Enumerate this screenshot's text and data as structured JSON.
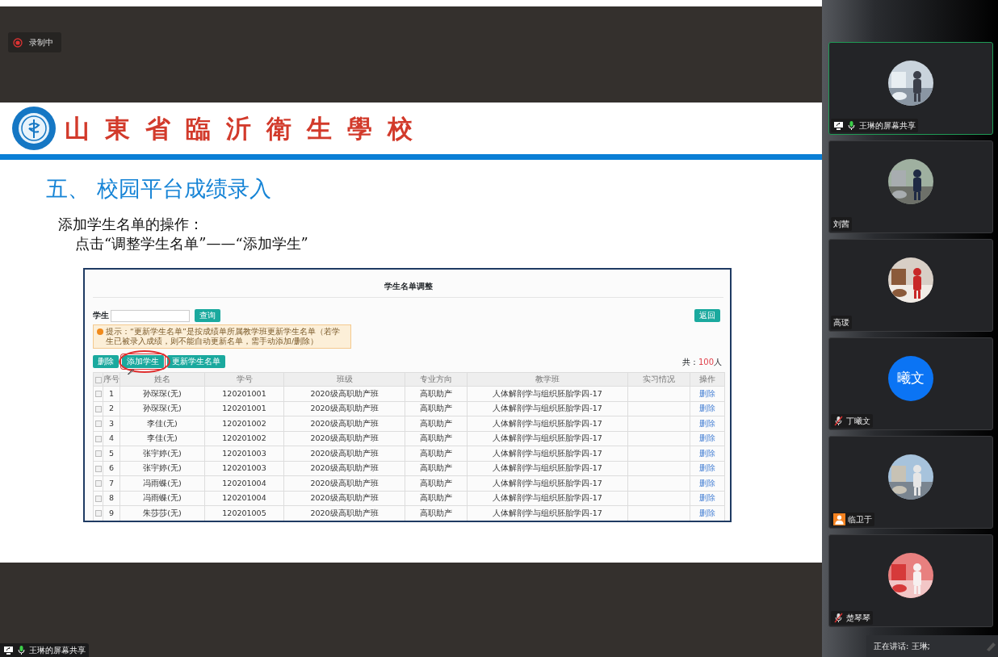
{
  "recording": {
    "label": "录制中"
  },
  "slide": {
    "school_name": "山東省臨沂衛生學校",
    "heading": "五、 校园平台成绩录入",
    "lines": [
      "添加学生名单的操作：",
      "点击“调整学生名单”——“添加学生”"
    ],
    "screenshot": {
      "title": "学生名单调整",
      "search_label": "学生",
      "search_button": "查询",
      "back_button": "返回",
      "notice": "提示：“更新学生名单”是按成绩单所属教学班更新学生名单（若学生已被录入成绩，则不能自动更新名单，需手动添加/删除）",
      "buttons": [
        {
          "label": "删除",
          "highlighted": false
        },
        {
          "label": "添加学生",
          "highlighted": true
        },
        {
          "label": "更新学生名单",
          "highlighted": false
        }
      ],
      "total": {
        "prefix": "共：",
        "count": "100",
        "unit": "人"
      },
      "header_checked": false,
      "columns": [
        "序号",
        "姓名",
        "学号",
        "班级",
        "专业方向",
        "教学班",
        "实习情况",
        "操作"
      ],
      "rows": [
        {
          "checked": false,
          "cells": [
            "1",
            "孙琛琛(无)",
            "120201001",
            "2020级高职助产班",
            "高职助产",
            "人体解剖学与组织胚胎学四-17"
          ],
          "action": "删除"
        },
        {
          "checked": false,
          "cells": [
            "2",
            "孙琛琛(无)",
            "120201001",
            "2020级高职助产班",
            "高职助产",
            "人体解剖学与组织胚胎学四-17"
          ],
          "action": "删除"
        },
        {
          "checked": false,
          "cells": [
            "3",
            "李佳(无)",
            "120201002",
            "2020级高职助产班",
            "高职助产",
            "人体解剖学与组织胚胎学四-17"
          ],
          "action": "删除"
        },
        {
          "checked": false,
          "cells": [
            "4",
            "李佳(无)",
            "120201002",
            "2020级高职助产班",
            "高职助产",
            "人体解剖学与组织胚胎学四-17"
          ],
          "action": "删除"
        },
        {
          "checked": false,
          "cells": [
            "5",
            "张宇婷(无)",
            "120201003",
            "2020级高职助产班",
            "高职助产",
            "人体解剖学与组织胚胎学四-17"
          ],
          "action": "删除"
        },
        {
          "checked": false,
          "cells": [
            "6",
            "张宇婷(无)",
            "120201003",
            "2020级高职助产班",
            "高职助产",
            "人体解剖学与组织胚胎学四-17"
          ],
          "action": "删除"
        },
        {
          "checked": false,
          "cells": [
            "7",
            "冯雨蝶(无)",
            "120201004",
            "2020级高职助产班",
            "高职助产",
            "人体解剖学与组织胚胎学四-17"
          ],
          "action": "删除"
        },
        {
          "checked": false,
          "cells": [
            "8",
            "冯雨蝶(无)",
            "120201004",
            "2020级高职助产班",
            "高职助产",
            "人体解剖学与组织胚胎学四-17"
          ],
          "action": "删除"
        },
        {
          "checked": false,
          "cells": [
            "9",
            "朱莎莎(无)",
            "120201005",
            "2020级高职助产班",
            "高职助产",
            "人体解剖学与组织胚胎学四-17"
          ],
          "action": "删除"
        }
      ]
    }
  },
  "participants": [
    {
      "name": "王琳的屏幕共享",
      "kind": "picture",
      "active": true,
      "icons": [
        {
          "kind": "share"
        },
        {
          "kind": "mic"
        }
      ]
    },
    {
      "name": "刘茜",
      "kind": "picture",
      "active": false
    },
    {
      "name": "高瑗",
      "kind": "picture",
      "active": false
    },
    {
      "name": "丁曦文",
      "kind": "initials",
      "initials": "曦文",
      "active": false,
      "icons": [
        {
          "kind": "muted"
        }
      ]
    },
    {
      "name": "临卫于",
      "kind": "picture",
      "active": false,
      "icons": [
        {
          "kind": "person"
        }
      ]
    },
    {
      "name": "楚琴琴",
      "kind": "picture",
      "active": false,
      "icons": [
        {
          "kind": "muted"
        }
      ]
    }
  ],
  "share_label": {
    "text": "王琳的屏幕共享",
    "icons": [
      {
        "kind": "share"
      },
      {
        "kind": "mic"
      }
    ]
  },
  "speaking": {
    "text": "正在讲话: 王琳;"
  }
}
